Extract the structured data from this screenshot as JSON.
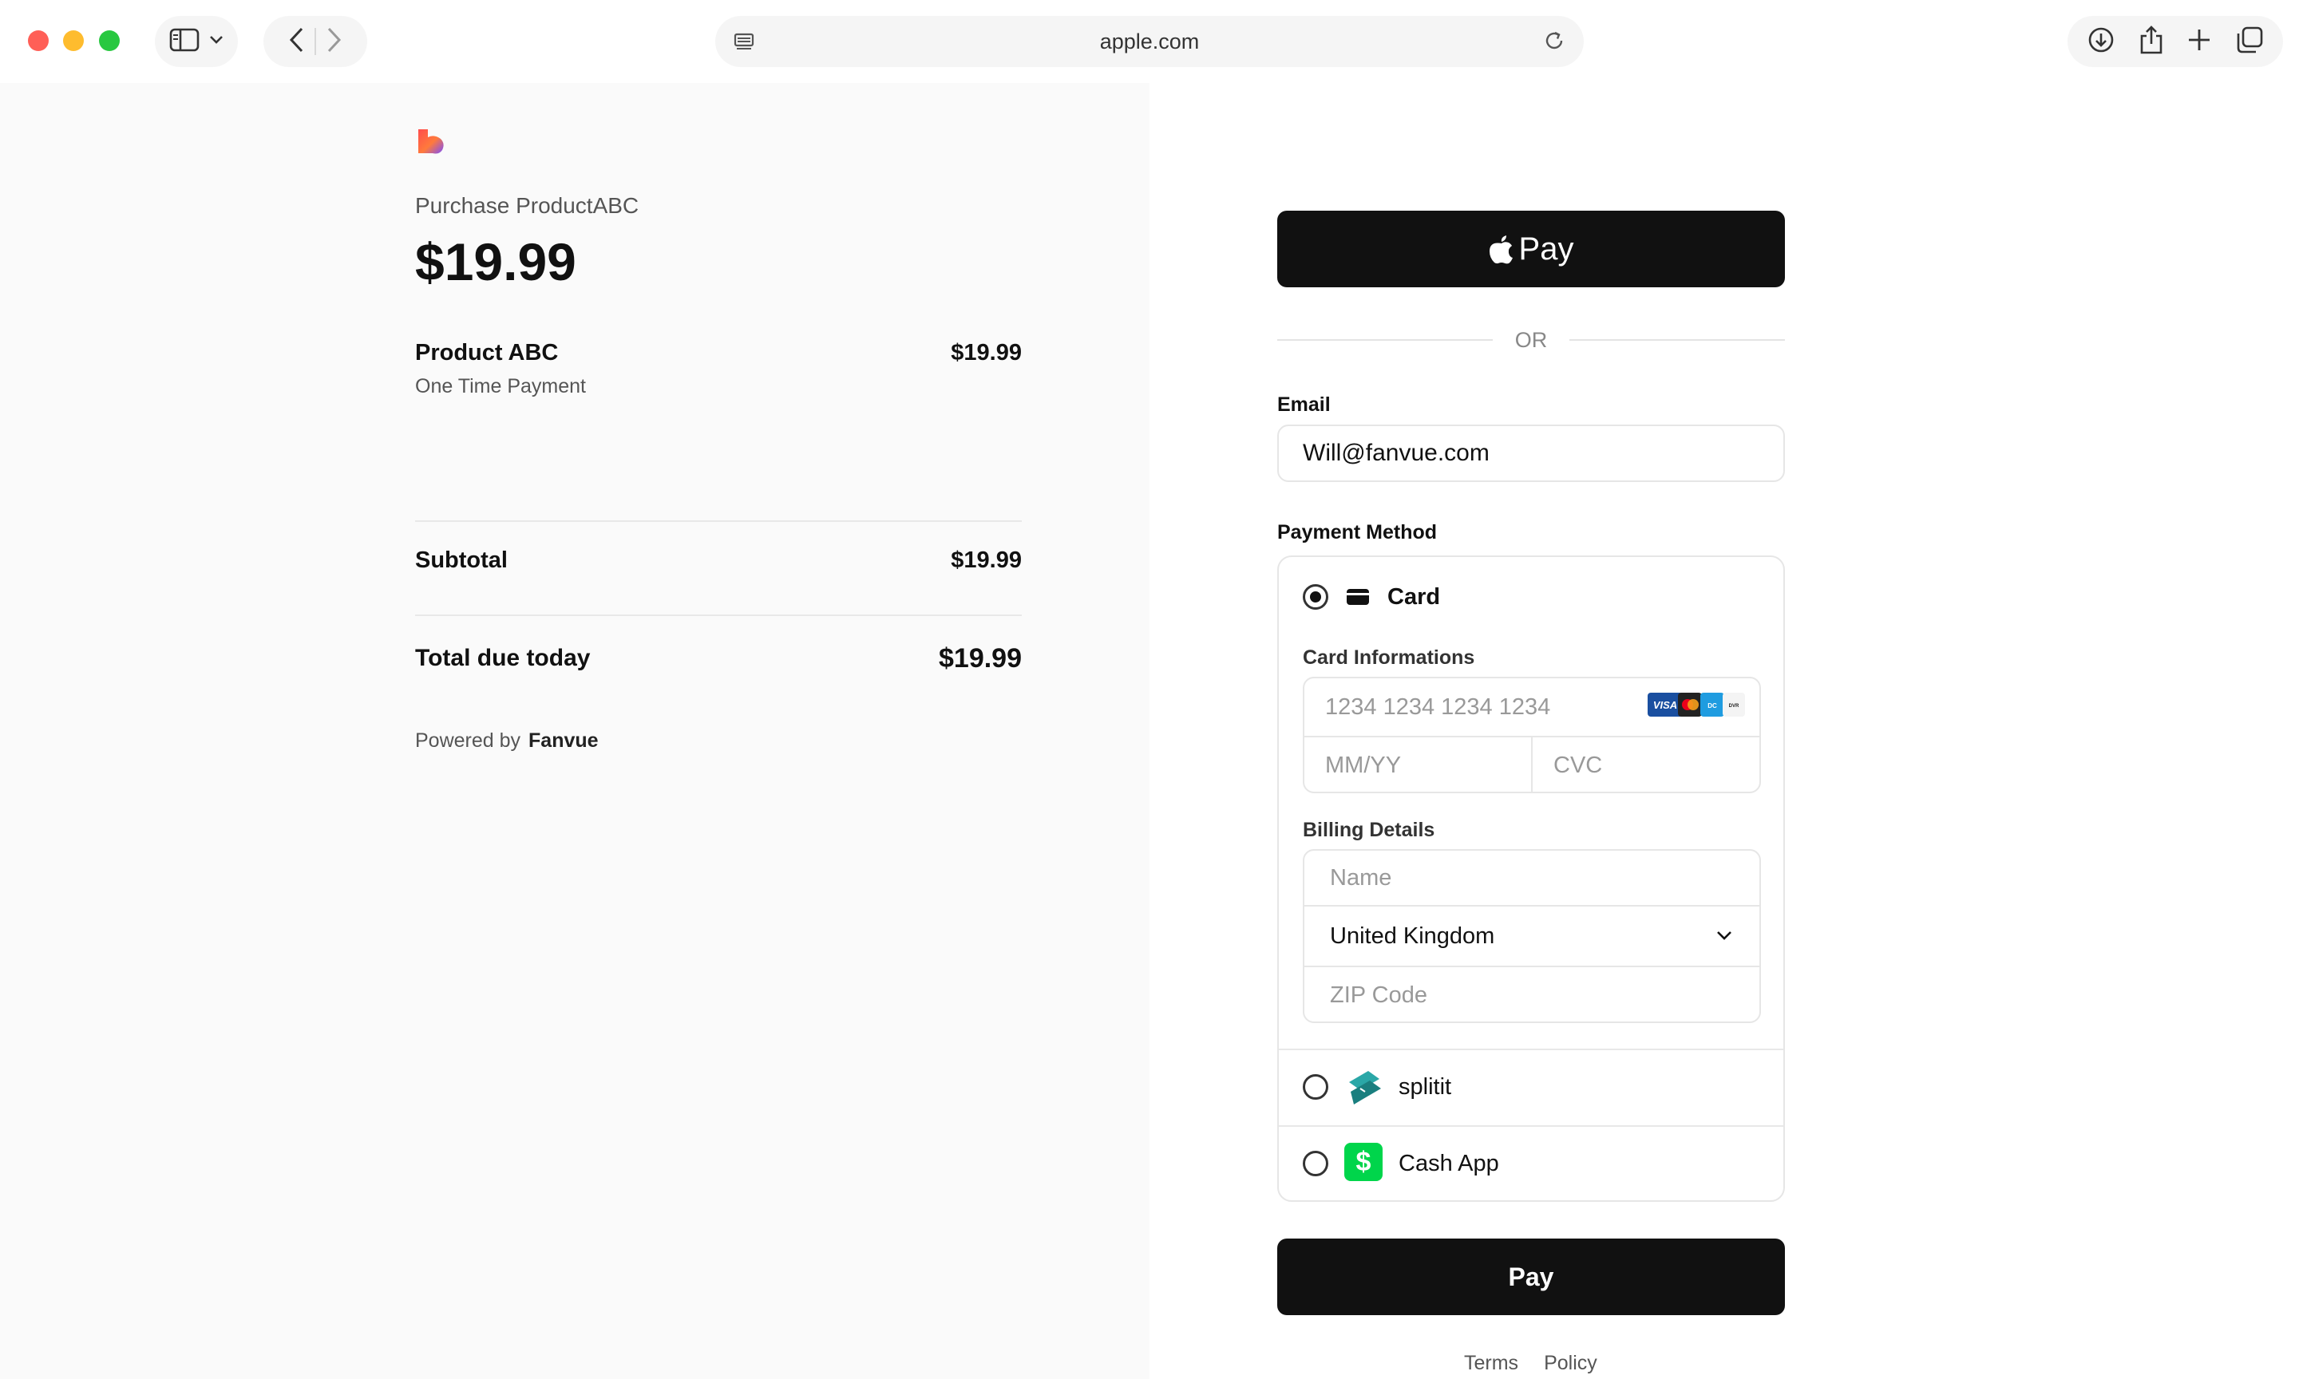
{
  "browser": {
    "url_host": "apple.com"
  },
  "summary": {
    "purchase_title": "Purchase ProductABC",
    "price": "$19.99",
    "product_name": "Product ABC",
    "product_subtitle": "One Time Payment",
    "product_price": "$19.99",
    "subtotal_label": "Subtotal",
    "subtotal_value": "$19.99",
    "total_label": "Total due today",
    "total_value": "$19.99",
    "powered_by": "Powered by",
    "powered_brand": "Fanvue"
  },
  "checkout": {
    "apple_pay_label": "Pay",
    "or_label": "OR",
    "email_label": "Email",
    "email_value": "Will@fanvue.com",
    "payment_method_label": "Payment Method",
    "card_label": "Card",
    "card_info_label": "Card Informations",
    "card_number_placeholder": "1234 1234 1234 1234",
    "expiry_placeholder": "MM/YY",
    "cvc_placeholder": "CVC",
    "billing_label": "Billing Details",
    "name_placeholder": "Name",
    "country_value": "United Kingdom",
    "zip_placeholder": "ZIP Code",
    "splitit_label": "splitit",
    "cashapp_label": "Cash App",
    "pay_button": "Pay",
    "cashapp_symbol": "$"
  },
  "footer": {
    "terms": "Terms",
    "policy": "Policy"
  },
  "colors": {
    "traffic_close": "#ff5f57",
    "traffic_min": "#febc2e",
    "traffic_max": "#28c840",
    "button_black": "#111111",
    "cashapp_green": "#00d54b",
    "splitit_teal": "#1f9b9b"
  },
  "icons": {
    "card": "credit-card-icon",
    "splitit": "splitit-logo-icon",
    "cashapp": "cash-app-logo-icon",
    "apple": "apple-logo-icon"
  }
}
